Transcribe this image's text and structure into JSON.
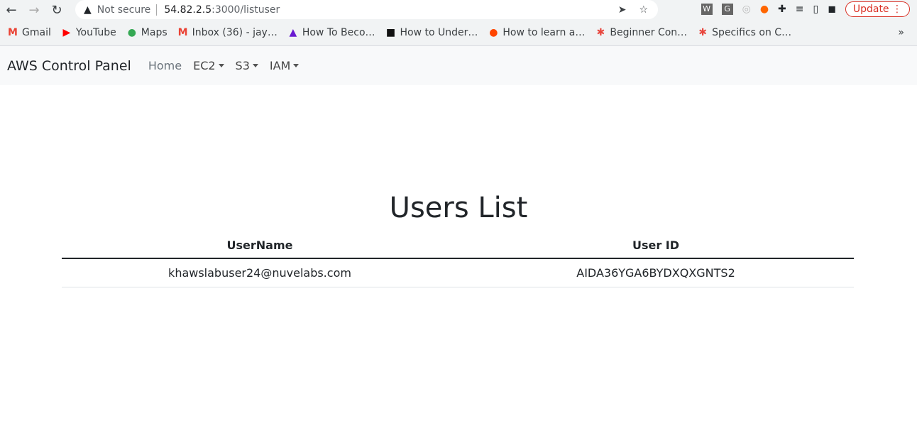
{
  "browser": {
    "security": "Not secure",
    "url_host": "54.82.2.5",
    "url_path": ":3000/listuser",
    "update_label": "Update",
    "extensions": [
      "W",
      "G"
    ],
    "bookmarks": [
      {
        "label": "Gmail",
        "icon": "M",
        "color": "#ea4335"
      },
      {
        "label": "YouTube",
        "icon": "▶",
        "color": "#ff0000"
      },
      {
        "label": "Maps",
        "icon": "●",
        "color": "#34a853"
      },
      {
        "label": "Inbox (36) - jay…",
        "icon": "M",
        "color": "#ea4335"
      },
      {
        "label": "How To Beco…",
        "icon": "▲",
        "color": "#6a1bd1"
      },
      {
        "label": "How to Under…",
        "icon": "■",
        "color": "#111111"
      },
      {
        "label": "How to learn a…",
        "icon": "●",
        "color": "#ff4500"
      },
      {
        "label": "Beginner Con…",
        "icon": "✱",
        "color": "#e8453c"
      },
      {
        "label": "Specifics on C…",
        "icon": "✱",
        "color": "#e8453c"
      }
    ],
    "more": "»"
  },
  "navbar": {
    "brand": "AWS Control Panel",
    "links": [
      "Home",
      "EC2",
      "S3",
      "IAM"
    ]
  },
  "main": {
    "title": "Users List",
    "headers": [
      "UserName",
      "User ID"
    ],
    "rows": [
      [
        "khawslabuser24@nuvelabs.com",
        "AIDA36YGA6BYDXQXGNTS2"
      ]
    ]
  }
}
